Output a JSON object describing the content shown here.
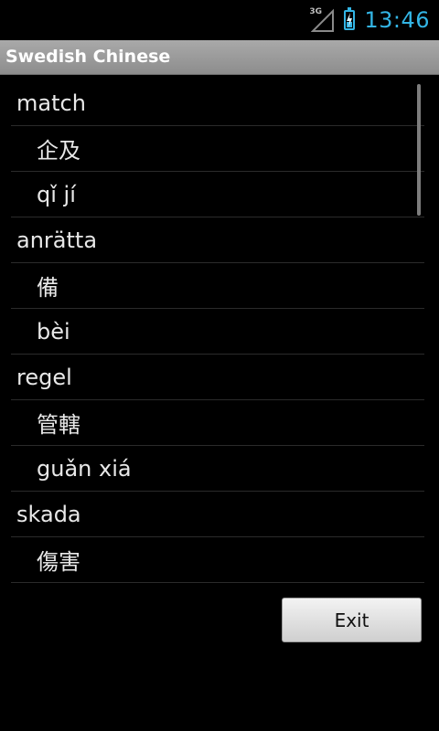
{
  "status_bar": {
    "network": "3G",
    "time": "13:46",
    "icons": [
      "signal-icon",
      "battery-charging-icon"
    ]
  },
  "title_bar": {
    "title": "Swedish Chinese"
  },
  "list": {
    "rows": [
      {
        "type": "word",
        "text": "match"
      },
      {
        "type": "sub",
        "text": "企及"
      },
      {
        "type": "sub",
        "text": "qǐ jí"
      },
      {
        "type": "word",
        "text": "anrätta"
      },
      {
        "type": "sub",
        "text": "備"
      },
      {
        "type": "sub",
        "text": "bèi"
      },
      {
        "type": "word",
        "text": "regel"
      },
      {
        "type": "sub",
        "text": "管轄"
      },
      {
        "type": "sub",
        "text": "guǎn xiá"
      },
      {
        "type": "word",
        "text": "skada"
      },
      {
        "type": "sub",
        "text": "傷害"
      }
    ]
  },
  "exit_button": {
    "label": "Exit"
  },
  "colors": {
    "accent": "#33b5e5",
    "background": "#000000",
    "title_bar": "#9a9a9a"
  }
}
